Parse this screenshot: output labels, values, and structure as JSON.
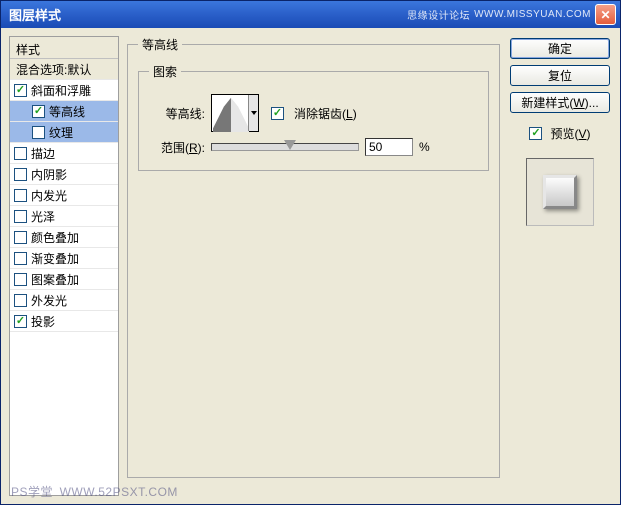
{
  "window": {
    "title": "图层样式",
    "forum": "思缘设计论坛",
    "url": "WWW.MISSYUAN.COM"
  },
  "leftPanel": {
    "header": "样式",
    "blend": "混合选项:默认",
    "items": {
      "bevel": "斜面和浮雕",
      "contour": "等高线",
      "texture": "纹理",
      "stroke": "描边",
      "innerShadow": "内阴影",
      "innerGlow": "内发光",
      "satin": "光泽",
      "colorOverlay": "颜色叠加",
      "gradientOverlay": "渐变叠加",
      "patternOverlay": "图案叠加",
      "outerGlow": "外发光",
      "dropShadow": "投影"
    }
  },
  "center": {
    "outerLegend": "等高线",
    "innerLegend": "图索",
    "contourLabel": "等高线:",
    "antiAlias": "消除锯齿(L)",
    "rangeLabel": "范围(R):",
    "rangeValue": "50",
    "percent": "%"
  },
  "right": {
    "ok": "确定",
    "cancel": "复位",
    "newStyle": "新建样式(W)...",
    "preview": "预览(V)"
  },
  "footer": {
    "brand": "PS学堂",
    "url": "WWW.52PSXT.COM"
  }
}
